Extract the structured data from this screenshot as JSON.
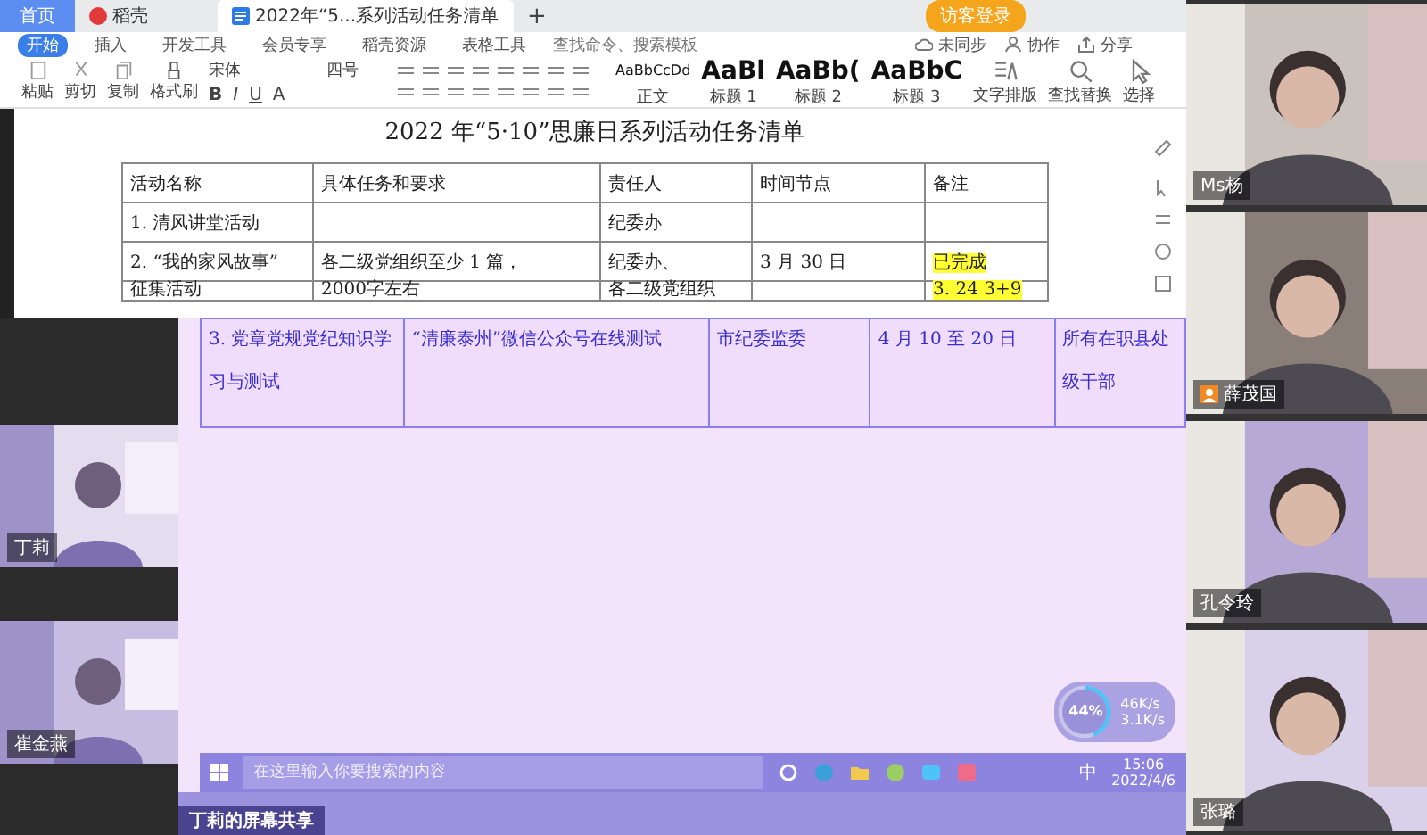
{
  "tabs": [
    {
      "label": "首页",
      "selected": false,
      "kind": "home"
    },
    {
      "label": "稻壳",
      "selected": false,
      "kind": "docer"
    },
    {
      "label": "2022年“5...系列活动任务清单",
      "selected": true,
      "kind": "doc"
    }
  ],
  "new_tab": "+",
  "guest_login": "访客登录",
  "menu": [
    {
      "label": "开始",
      "selected": true
    },
    {
      "label": "插入",
      "selected": false
    },
    {
      "label": "开发工具",
      "selected": false
    },
    {
      "label": "会员专享",
      "selected": false
    },
    {
      "label": "稻壳资源",
      "selected": false
    },
    {
      "label": "表格工具",
      "selected": false
    }
  ],
  "search": {
    "placeholder": "查找命令、搜索模板"
  },
  "actions": [
    {
      "label": "未同步",
      "kind": "cloud"
    },
    {
      "label": "协作",
      "kind": "person"
    },
    {
      "label": "分享",
      "kind": "share"
    }
  ],
  "ribbon": {
    "clipboard": [
      {
        "label": "粘贴",
        "kind": "paste"
      },
      {
        "label": "剪切",
        "kind": "cut"
      },
      {
        "label": "复制",
        "kind": "copy"
      },
      {
        "label": "格式刷",
        "kind": "brush"
      }
    ],
    "font": "宋体",
    "size": "四号",
    "format": [
      "B",
      "I",
      "U",
      "A"
    ],
    "styles": [
      {
        "sample": "AaBbCcDd",
        "label": "正文"
      },
      {
        "sample": "AaBl",
        "label": "标题 1"
      },
      {
        "sample": "AaBb(",
        "label": "标题 2"
      },
      {
        "sample": "AaBbC",
        "label": "标题 3"
      }
    ],
    "tools": [
      {
        "label": "文字排版",
        "kind": "layout"
      },
      {
        "label": "查找替换",
        "kind": "search"
      },
      {
        "label": "选择",
        "kind": "cursor"
      }
    ]
  },
  "document": {
    "title": "2022 年“5·10”思廉日系列活动任务清单",
    "columns": [
      "活动名称",
      "具体任务和要求",
      "责任人",
      "时间节点",
      "备注"
    ],
    "rows": [
      {
        "cells": [
          {
            "text": "1.  清风讲堂活动"
          },
          null,
          {
            "text": "纪委办"
          },
          null,
          null
        ]
      },
      {
        "cells": [
          {
            "text": "2.  “我的家风故事”"
          },
          {
            "text": "各二级党组织至少 1 篇，"
          },
          {
            "text": "纪委办、"
          },
          {
            "text": "3 月 30 日"
          },
          {
            "text": "已完成",
            "color": "#ffff33"
          }
        ]
      },
      {
        "cells": [
          {
            "text": "征集活动"
          },
          {
            "text": "2000字左右"
          },
          {
            "text": "各二级党组织"
          },
          null,
          {
            "text": "3. 24  3+9",
            "color": "#ffff33"
          }
        ]
      }
    ]
  },
  "shared_rows": [
    {
      "cells": [
        "3.  党章党规党纪知识学习与测试",
        "“清廉泰州”微信公众号在线测试",
        "市纪委监委",
        "4 月 10 至 20 日",
        "所有在职县处级干部"
      ]
    }
  ],
  "participants": [
    {
      "name": "Ms杨",
      "host": false
    },
    {
      "name": "薛茂国",
      "host": true
    },
    {
      "name": "孔令玲",
      "host": false
    },
    {
      "name": "张璐",
      "host": false
    },
    {
      "name": "丁莉",
      "host": false
    },
    {
      "name": "崔金燕",
      "host": false
    }
  ],
  "network": {
    "percent": "44%",
    "level": 0.44,
    "up": "46K/s",
    "down": "3.1K/s"
  },
  "taskbar": {
    "placeholder": "在这里输入你要搜索的内容",
    "ime": "中",
    "time": "15:06",
    "date": "2022/4/6"
  },
  "share_label": "丁莉的屏幕共享"
}
